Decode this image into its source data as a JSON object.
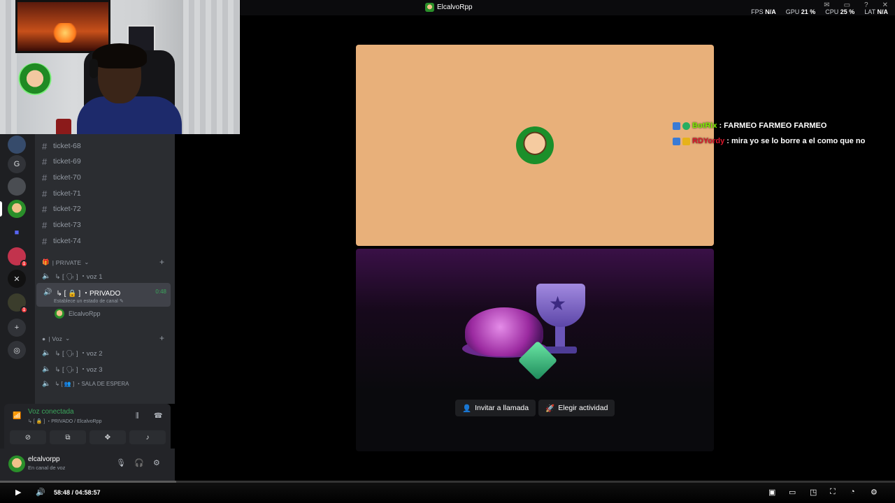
{
  "window": {
    "title": "ElcalvoRpp"
  },
  "stats": {
    "fps_label": "FPS",
    "fps_value": "N/A",
    "gpu_label": "GPU",
    "gpu_value": "21 %",
    "cpu_label": "CPU",
    "cpu_value": "25 %",
    "lat_label": "LAT",
    "lat_value": "N/A"
  },
  "servers": {
    "letter_server": "G",
    "badge_1": "1",
    "badge_2": "1"
  },
  "channels": {
    "text": [
      "ticket-68",
      "ticket-69",
      "ticket-70",
      "ticket-71",
      "ticket-72",
      "ticket-73",
      "ticket-74"
    ],
    "cat_private": "| PRIVATE",
    "voice_private": [
      "↳ [ 🗣 ]  ・voz 1"
    ],
    "active": {
      "name": "↳ [ 🔒 ]  ・PRIVADO",
      "timer": "0:48",
      "status": "Establece un estado de canal"
    },
    "voice_user": "ElcalvoRpp",
    "cat_voz": "| Voz",
    "voice_voz": [
      "↳ [ 🗣 ]  ・voz 2",
      "↳ [ 🗣 ]  ・voz 3",
      "↳ [ 👥 ]  ・SALA DE ESPERA"
    ]
  },
  "voice_panel": {
    "title": "Voz conectada",
    "subtitle": "↳ [ 🔒 ]  ・PRIVADO / ElcalvoRpp"
  },
  "user_panel": {
    "name": "elcalvorpp",
    "status": "En canal de voz"
  },
  "activity": {
    "invite_label": "Invitar a llamada",
    "choose_label": "Elegir actividad"
  },
  "chat": [
    {
      "user": "BotRix",
      "message": ": FARMEO FARMEO FARMEO",
      "color": "#7cf000"
    },
    {
      "user": "RDYordy",
      "message": ": mira yo se lo borre a el como que no",
      "color": "#e0162b"
    }
  ],
  "player": {
    "time": "58:48 / 04:58:57",
    "progress": 0.197
  }
}
